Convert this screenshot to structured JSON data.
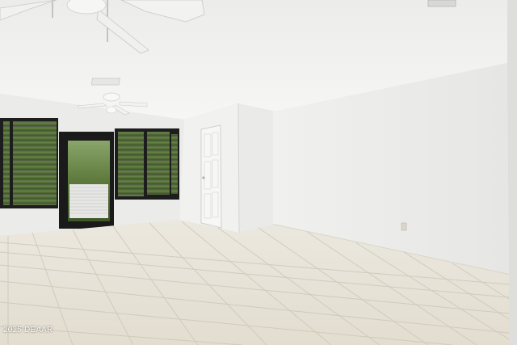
{
  "photo": {
    "watermark": "2025 DEAAR"
  },
  "colors": {
    "ceiling": "#f3f3f1",
    "wall_back": "#ededeb",
    "wall_side": "#e4e4e2",
    "floor_tile": "#e7e3d8",
    "grout": "#c9c3b3",
    "door": "#f4f4f2",
    "window_frame": "#1e1e1e",
    "blinds": "#3a3a3a",
    "foliage": "#5f7a3e"
  }
}
